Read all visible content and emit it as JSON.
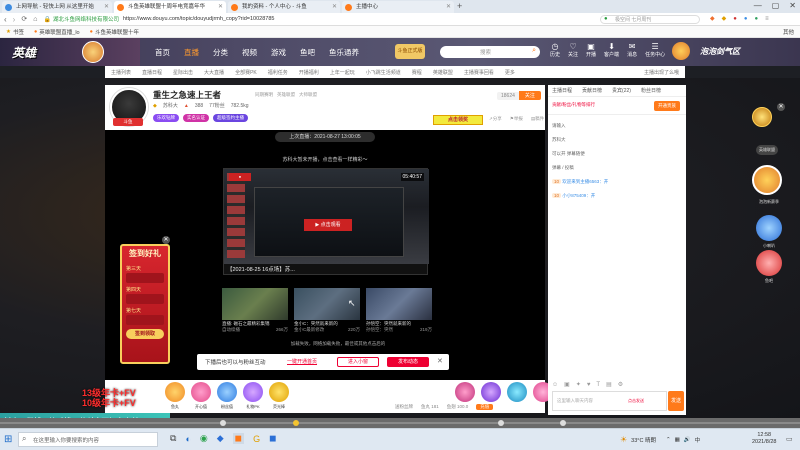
{
  "browser": {
    "tabs": [
      {
        "label": "上网导航 - 轻快上网 从这里开始",
        "active": false,
        "color": "#3d8be0"
      },
      {
        "label": "斗鱼英雄联盟十周年电竞嘉年华",
        "active": true,
        "color": "#ff7a1a"
      },
      {
        "label": "我的资料 - 个人中心 - 斗鱼",
        "active": false,
        "color": "#ff7a1a"
      },
      {
        "label": "主播中心",
        "active": false,
        "color": "#ff7a1a"
      }
    ],
    "url_secure": "湖北斗鱼网络科技有限公司",
    "url": "https://www.douyu.com/topic/douyudjrmh_copy?rid=10028785",
    "search_placeholder": "极空间 七月周刊",
    "bookmarks": [
      {
        "label": "书签"
      },
      {
        "label": "英雄联盟直播_lo"
      },
      {
        "label": "斗鱼英雄联盟十年"
      }
    ],
    "bookmark_more": "其他"
  },
  "site": {
    "logo": "英雄",
    "nav": [
      "首页",
      "直播",
      "分类",
      "视频",
      "游戏",
      "鱼吧",
      "鱼乐通养"
    ],
    "promo_text": "斗鱼正式版",
    "search_placeholder": "搜索",
    "header_icons": [
      "历史",
      "关注",
      "开播",
      "客户端",
      "消息",
      "任务中心"
    ],
    "banner_right": "泡泡剑气区",
    "subnav": [
      "主播列表",
      "直播日程",
      "星际出击",
      "大大直播",
      "全部赛PK",
      "福利任务",
      "开播福利",
      "上年一起玩",
      "小飞跳生活频道",
      "赛程",
      "英雄联盟",
      "主播赛事回看",
      "更多"
    ],
    "subnav_right": "主播出现了么哦"
  },
  "streamer": {
    "avatar_label": "斗鱼",
    "title": "重生之急速上王者",
    "meta": [
      "同期赛明",
      "英雄联盟",
      "大师联盟"
    ],
    "name": "苏科大",
    "level": "388",
    "followers": "77粉丝",
    "hot": "782.5kg",
    "badges": [
      "乐欢钻牌",
      "实名认证",
      "超级签约主播"
    ],
    "fans_count": "18624",
    "follow_btn": "关注",
    "right_actions": [
      "分享",
      "举报",
      "稿件"
    ],
    "promo_btn": "直播",
    "promo_label": "点击领奖"
  },
  "video": {
    "last_live": "上次直播：2021-08-27 13:00:05",
    "room_desc": "苏科大暂未开播，点击查看一样精彩～",
    "video_title": "【2021-08-25 16点场】苏...",
    "duration": "05:40:57",
    "play_btn": "点击观看",
    "thumbs": [
      {
        "title": "直播: 磁石之最精彩集锦",
        "sub": "自动续播",
        "views": "266万"
      },
      {
        "title": "金小C：突然就来新的",
        "sub": "金小C最新修改",
        "views": "220万"
      },
      {
        "title": "孙悟空：突然就来新的",
        "sub": "孙悟空：突然",
        "views": "219万"
      }
    ],
    "fail_text": "加载失败，网络加载失败，最佳或其他点击后的",
    "banner_text": "下播后也可以与粉丝互动",
    "banner_link": "一键开通首页",
    "banner_btn1": "进入小窗",
    "banner_btn2": "发布动态"
  },
  "signin": {
    "title": "签到好礼",
    "days": [
      "第三天",
      "第四天",
      "第七天"
    ],
    "btn": "签到领取"
  },
  "chat": {
    "tabs": [
      "主播日程",
      "贡献日榜",
      "贵宾(22)",
      "粉丝日榜"
    ],
    "top_tabs": [
      "英雄联盟",
      "主播日程"
    ],
    "notice": "贡献/粉丝/礼物等排行",
    "join_btn": "开通贵族",
    "items": [
      "请输入",
      "苏科大",
      "可以开 弹幕随便",
      "弹幕 / 投稿"
    ],
    "user1": "欢迎来到主播6563：开",
    "user2": "小小875409：开",
    "input_placeholder": "这里输入聊天内容",
    "send_btn": "发送",
    "input_hint": "点击发送"
  },
  "gifts": {
    "items": [
      "鱼丸",
      "开心值",
      "粉丝值",
      "礼物PK",
      "荧光棒",
      "荧光棒"
    ],
    "bottom": [
      "送粉丝牌",
      "鱼丸 181",
      "鱼翅 100.0",
      "充值"
    ]
  },
  "ad": {
    "line1": "13级年卡+FV",
    "line2": "10级年卡+FV",
    "banner": "抖音、微博、快手搜：苏科大不知名上单"
  },
  "side": {
    "items": [
      "英雄联盟",
      "泡泡新赛季",
      "小喇叭",
      "鱼吧"
    ]
  },
  "taskbar": {
    "search_placeholder": "在这里输入你要搜索的内容",
    "weather": "33°C 晴朗",
    "time": "12:58",
    "date": "2021/8/28"
  }
}
